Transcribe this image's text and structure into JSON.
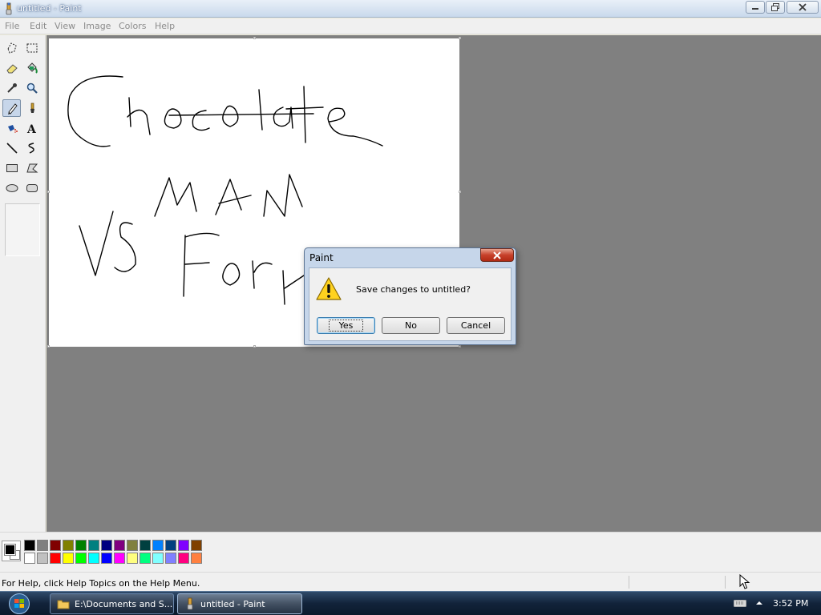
{
  "window": {
    "title": "untitled - Paint"
  },
  "menu": {
    "items": [
      "File",
      "Edit",
      "View",
      "Image",
      "Colors",
      "Help"
    ]
  },
  "tools": [
    "free-form-select",
    "rect-select",
    "eraser",
    "fill-with-color",
    "pick-color",
    "magnifier",
    "pencil",
    "brush",
    "airbrush",
    "text",
    "line",
    "curve",
    "rectangle",
    "polygon",
    "ellipse",
    "rounded-rectangle"
  ],
  "selected_tool": "pencil",
  "canvas_drawing": {
    "description_words": [
      "Chocolate",
      "MAN",
      "VS",
      "For"
    ]
  },
  "palette": {
    "top": [
      "#000000",
      "#808080",
      "#800000",
      "#808000",
      "#008000",
      "#008080",
      "#000080",
      "#800080",
      "#808040",
      "#004040",
      "#0080ff",
      "#004080",
      "#8000ff",
      "#804000"
    ],
    "bottom": [
      "#ffffff",
      "#c0c0c0",
      "#ff0000",
      "#ffff00",
      "#00ff00",
      "#00ffff",
      "#0000ff",
      "#ff00ff",
      "#ffff80",
      "#00ff80",
      "#80ffff",
      "#8080ff",
      "#ff0080",
      "#ff8040"
    ],
    "foreground": "#000000",
    "background": "#ffffff"
  },
  "status": {
    "text": "For Help, click Help Topics on the Help Menu."
  },
  "dialog": {
    "title": "Paint",
    "message": "Save changes to untitled?",
    "buttons": {
      "yes": "Yes",
      "no": "No",
      "cancel": "Cancel"
    }
  },
  "taskbar": {
    "tasks": [
      {
        "label": "E:\\Documents and S...",
        "icon": "folder-icon"
      },
      {
        "label": "untitled - Paint",
        "icon": "paint-icon"
      }
    ],
    "clock": "3:52 PM"
  }
}
